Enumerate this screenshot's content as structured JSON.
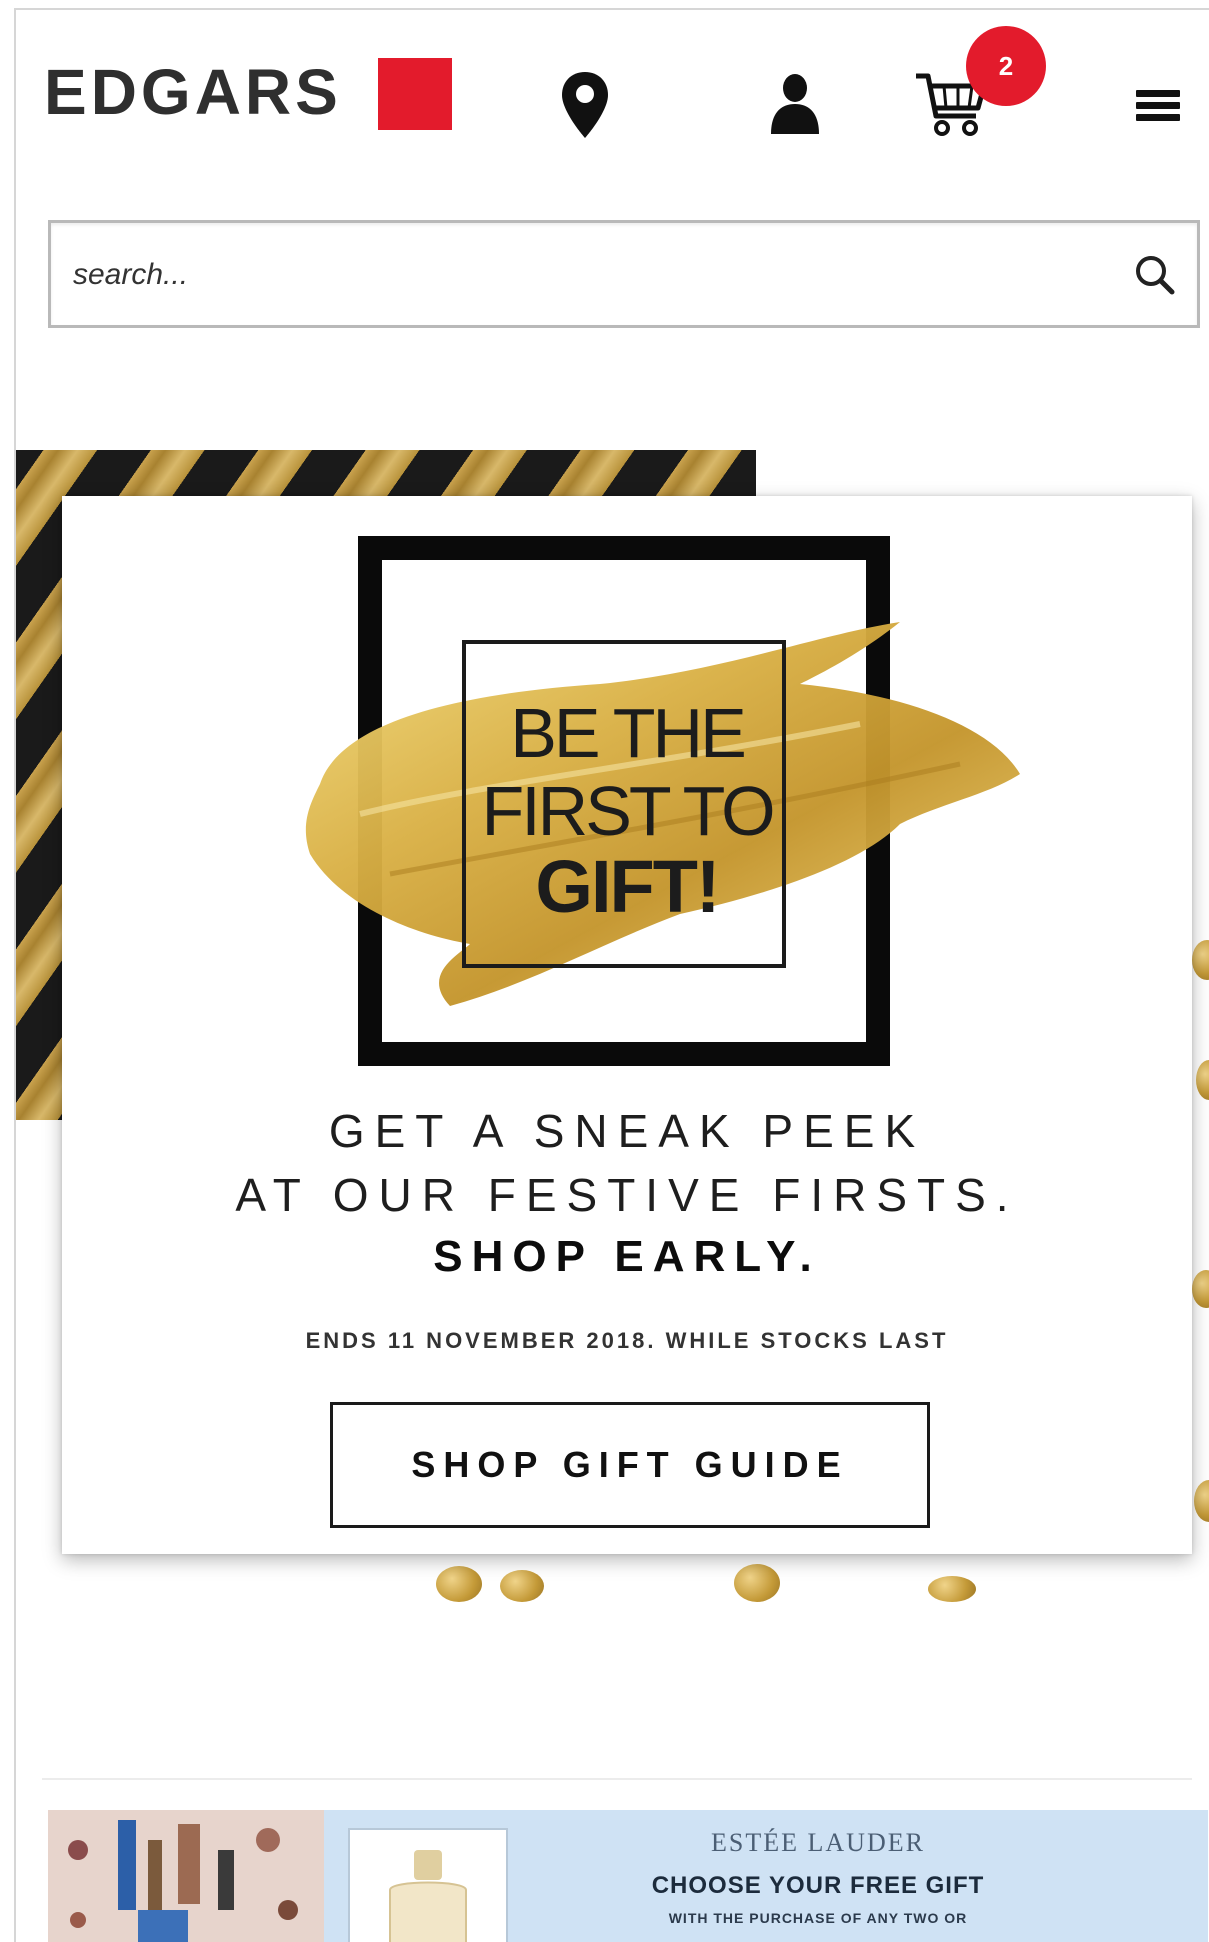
{
  "header": {
    "logo": "EDGARS",
    "cart_count": "2",
    "brand_color": "#e31b2c"
  },
  "search": {
    "placeholder": "search..."
  },
  "hero": {
    "headline_1": "BE THE",
    "headline_2": "FIRST TO",
    "headline_3": "GIFT!",
    "copy_1": "GET A SNEAK PEEK",
    "copy_2": "AT OUR FESTIVE FIRSTS.",
    "copy_3": "SHOP EARLY.",
    "fineprint": "ENDS 11 NOVEMBER 2018. WHILE STOCKS LAST",
    "cta_label": "SHOP GIFT GUIDE"
  },
  "banner": {
    "brand": "ESTÉE LAUDER",
    "title": "CHOOSE YOUR FREE GIFT",
    "subtitle": "WITH THE PURCHASE OF ANY TWO OR"
  },
  "icons": [
    "location-pin-icon",
    "account-icon",
    "cart-icon",
    "hamburger-menu-icon",
    "search-icon"
  ]
}
